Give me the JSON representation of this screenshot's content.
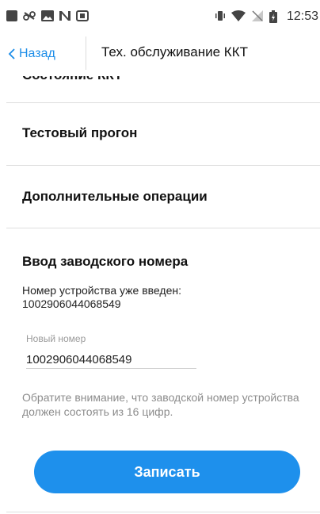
{
  "status_bar": {
    "time": "12:53",
    "icons": [
      "stop-square-icon",
      "link-off-icon",
      "image-icon",
      "nfc-icon",
      "screenshot-icon",
      "vibrate-icon",
      "wifi-icon",
      "no-sim-icon",
      "battery-charging-icon"
    ]
  },
  "header": {
    "back_label": "Назад",
    "title": "Тех. обслуживание ККТ"
  },
  "menu": {
    "items": [
      {
        "label": "Состояние ККТ"
      },
      {
        "label": "Тестовый прогон"
      },
      {
        "label": "Дополнительные операции"
      }
    ]
  },
  "serial": {
    "title": "Ввод заводского номера",
    "entered_label": "Номер устройства уже введен:",
    "entered_value": "1002906044068549",
    "input_label": "Новый номер",
    "input_value": "1002906044068549",
    "note": "Обратите внимание, что заводской номер устройства должен состоять из 16 цифр.",
    "submit_label": "Записать"
  },
  "colors": {
    "accent": "#1e90ec",
    "link": "#1c8de8"
  }
}
